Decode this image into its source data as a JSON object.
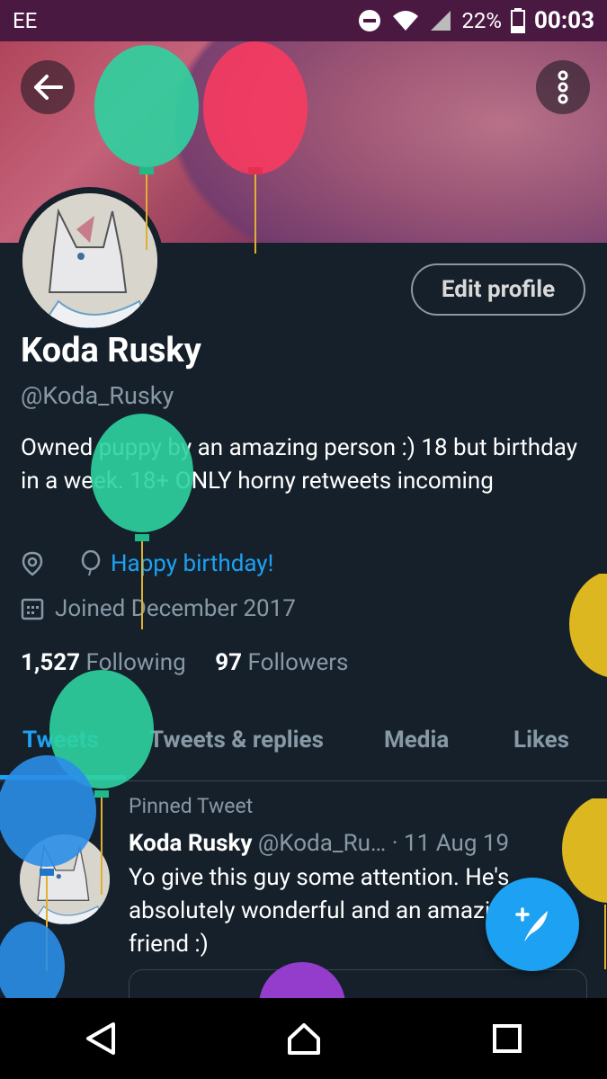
{
  "status_bar": {
    "carrier": "EE",
    "battery": "22%",
    "time": "00:03"
  },
  "profile": {
    "name": "Koda Rusky",
    "handle": "@Koda_Rusky",
    "bio": "Owned puppy by an amazing person :) 18 but birthday in a week. 18+ ONLY horny retweets incoming",
    "birthday_text": "Happy birthday!",
    "joined": "Joined December 2017",
    "following_count": "1,527",
    "following_label": "Following",
    "followers_count": "97",
    "followers_label": "Followers",
    "edit_label": "Edit profile"
  },
  "tabs": [
    {
      "label": "Tweets"
    },
    {
      "label": "Tweets & replies"
    },
    {
      "label": "Media"
    },
    {
      "label": "Likes"
    }
  ],
  "tweet": {
    "pinned_label": "Pinned Tweet",
    "author": "Koda Rusky",
    "handle": "@Koda_Ru…",
    "date": "· 11 Aug 19",
    "text": "Yo give this guy some attention. He's absolutely wonderful and an amazing friend :)"
  },
  "colors": {
    "background": "#15202b",
    "accent": "#1da1f2",
    "muted": "#8899a6",
    "status_bar": "#4a1942"
  },
  "icons": {
    "back": "arrow-left",
    "more": "vertical-dots",
    "location": "pin",
    "birthday": "balloon",
    "calendar": "calendar",
    "compose": "feather-plus",
    "nav_back": "triangle",
    "nav_home": "house",
    "nav_recent": "square"
  }
}
